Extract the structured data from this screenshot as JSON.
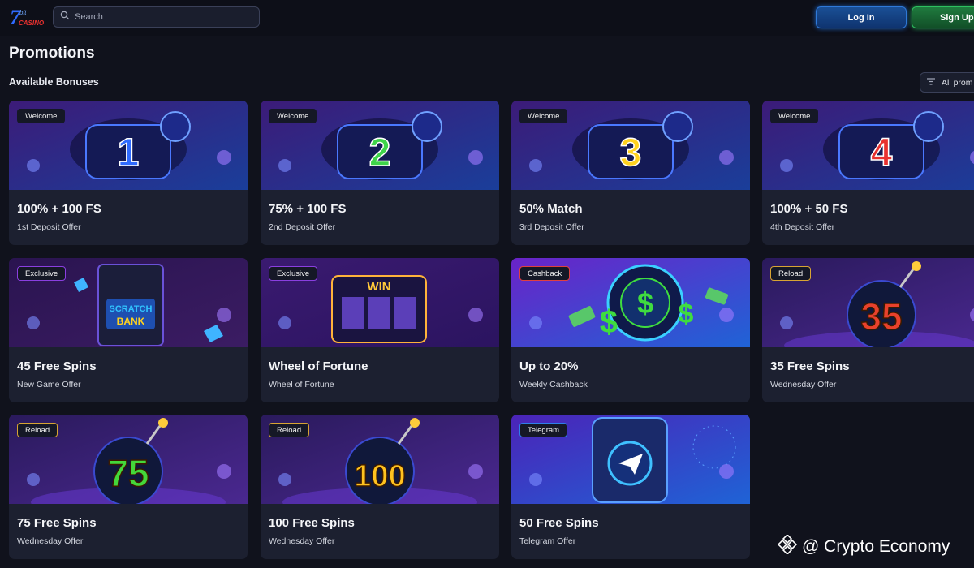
{
  "header": {
    "logo_text": "CASINO",
    "search_placeholder": "Search",
    "login_label": "Log In",
    "signup_label": "Sign Up"
  },
  "page": {
    "title": "Promotions",
    "section_title": "Available Bonuses",
    "filter_label": "All prom"
  },
  "promotions": [
    {
      "badge": "Welcome",
      "title": "100% + 100 FS",
      "subtitle": "1st Deposit Offer",
      "art_text": "1",
      "art_color": "#2f6bff"
    },
    {
      "badge": "Welcome",
      "title": "75% + 100 FS",
      "subtitle": "2nd Deposit Offer",
      "art_text": "2",
      "art_color": "#3fd44a"
    },
    {
      "badge": "Welcome",
      "title": "50% Match",
      "subtitle": "3rd Deposit Offer",
      "art_text": "3",
      "art_color": "#ffd21f"
    },
    {
      "badge": "Welcome",
      "title": "100% + 50 FS",
      "subtitle": "4th Deposit Offer",
      "art_text": "4",
      "art_color": "#e8312f"
    },
    {
      "badge": "Exclusive",
      "title": "45 Free Spins",
      "subtitle": "New Game Offer",
      "art_text": "SCRATCH BANK",
      "art_color": "#31c3ff"
    },
    {
      "badge": "Exclusive",
      "title": "Wheel of Fortune",
      "subtitle": "Wheel of Fortune",
      "art_text": "WIN",
      "art_color": "#ffc83a"
    },
    {
      "badge": "Cashback",
      "title": "Up to 20%",
      "subtitle": "Weekly Cashback",
      "art_text": "$",
      "art_color": "#3fdc3f"
    },
    {
      "badge": "Reload",
      "title": "35 Free Spins",
      "subtitle": "Wednesday Offer",
      "art_text": "35",
      "art_color": "#e8412c"
    },
    {
      "badge": "Reload",
      "title": "75 Free Spins",
      "subtitle": "Wednesday Offer",
      "art_text": "75",
      "art_color": "#44d83a"
    },
    {
      "badge": "Reload",
      "title": "100 Free Spins",
      "subtitle": "Wednesday Offer",
      "art_text": "100",
      "art_color": "#ffc21f"
    },
    {
      "badge": "Telegram",
      "title": "50 Free Spins",
      "subtitle": "Telegram Offer",
      "art_text": "",
      "art_color": "#2f86ff"
    }
  ],
  "watermark": {
    "text": "@ Crypto Economy"
  }
}
